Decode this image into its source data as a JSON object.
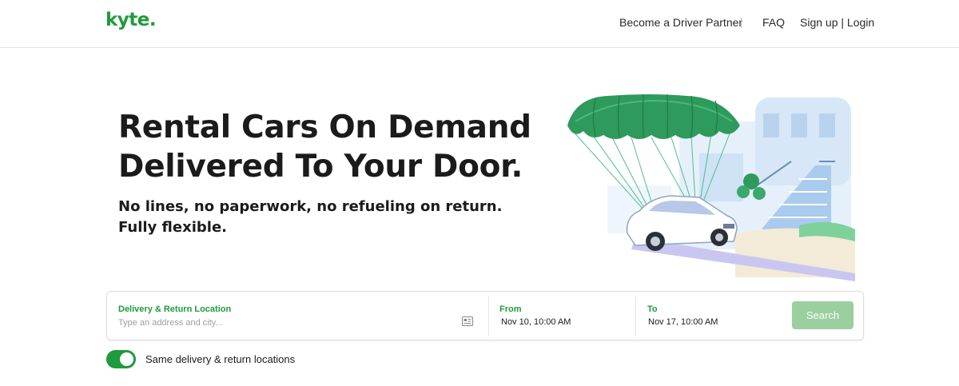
{
  "header": {
    "logo_text": "kyte",
    "logo_dot": ".",
    "nav": {
      "driver_partner": "Become a Driver Partner",
      "separator": "|",
      "faq": "FAQ",
      "auth": "Sign up | Login"
    }
  },
  "hero": {
    "title_line1": "Rental Cars On Demand",
    "title_line2": "Delivered To Your Door.",
    "subtitle_line1": "No lines, no paperwork, no refueling on return.",
    "subtitle_line2": "Fully flexible."
  },
  "search": {
    "location_label": "Delivery & Return Location",
    "location_placeholder": "Type an address and city...",
    "from_label": "From",
    "from_value": "Nov 10, 10:00 AM",
    "to_label": "To",
    "to_value": "Nov 17, 10:00 AM",
    "search_button": "Search"
  },
  "options": {
    "same_location_label": "Same delivery & return locations",
    "same_location_enabled": true
  },
  "colors": {
    "brand_green": "#1f9a3e",
    "search_button_disabled": "#9ccf9f",
    "parachute_green": "#2e9a5c"
  },
  "icons": {
    "location_input_icon": "address-card-icon"
  }
}
